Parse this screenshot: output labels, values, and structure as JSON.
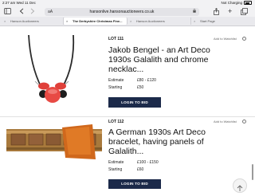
{
  "status": {
    "time_date": "2:27 am  Wed 11 Dec",
    "right": "Not Charging"
  },
  "toolbar": {
    "text_size": "aA",
    "url": "hansonlive.hansonauctioneers.co.uk"
  },
  "tabs": [
    {
      "label": "Hanson Auctioneers"
    },
    {
      "label": "The Derbyshire Christmas Fine..."
    },
    {
      "label": "Hanson Auctioneers"
    },
    {
      "label": "Start Page"
    }
  ],
  "lots": [
    {
      "lot": "LOT 111",
      "watch": "Add to Watchlist",
      "title": "Jakob Bengel - an Art Deco 1930s Galalith and chrome necklac...",
      "estimate_label": "Estimate",
      "estimate": "£80 - £120",
      "starting_label": "Starting",
      "starting": "£50",
      "button": "LOGIN TO BID"
    },
    {
      "lot": "LOT 112",
      "watch": "Add to Watchlist",
      "title": "A German 1930s Art Deco bracelet, having panels of Galalith...",
      "estimate_label": "Estimate",
      "estimate": "£100 - £150",
      "starting_label": "Starting",
      "starting": "£60",
      "button": "LOGIN TO BID"
    }
  ],
  "icons": [
    "sidebar-icon",
    "back-icon",
    "forward-icon",
    "lock-icon",
    "share-icon",
    "add-tab-icon",
    "tabs-icon",
    "close-icon",
    "up-arrow-icon"
  ],
  "colors": {
    "button": "#1c2a4a",
    "necklace_beads": "#e0403a"
  }
}
